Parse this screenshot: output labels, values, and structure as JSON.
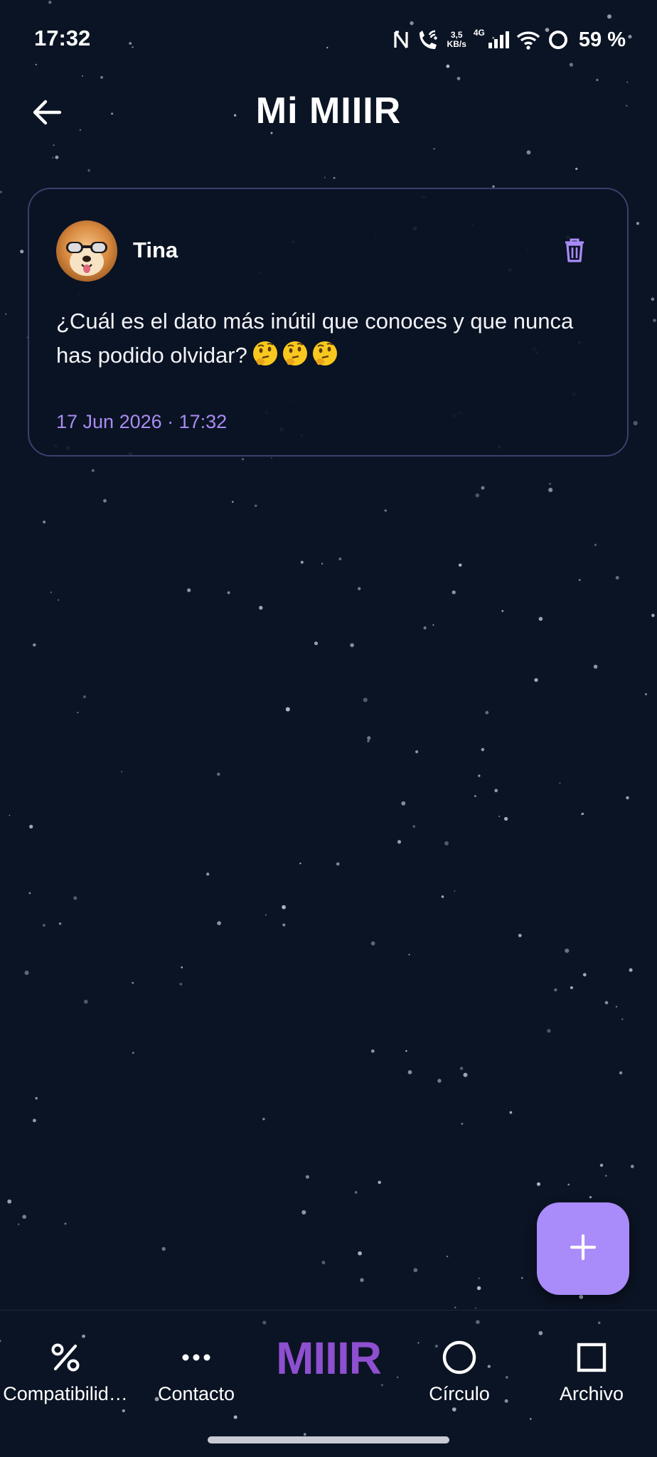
{
  "status_bar": {
    "time": "17:32",
    "net_speed_value": "3,5",
    "net_speed_unit": "KB/s",
    "network_type": "4G",
    "battery": "59 %"
  },
  "header": {
    "title": "Mi MIIIR"
  },
  "post": {
    "author": "Tina",
    "text": "¿Cuál es el dato más inútil que conoces y que nunca has podido olvidar?",
    "emojis": [
      "thinking-face",
      "thinking-face",
      "thinking-face"
    ],
    "date": "17 Jun 2026 · 17:32"
  },
  "bottom_nav": {
    "items": [
      {
        "label": "Compatibilid…",
        "icon": "percent-icon"
      },
      {
        "label": "Contacto",
        "icon": "more-dots-icon"
      },
      {
        "label": "MIIIR",
        "icon": "logo"
      },
      {
        "label": "Círculo",
        "icon": "circle-icon"
      },
      {
        "label": "Archivo",
        "icon": "square-icon"
      }
    ]
  },
  "colors": {
    "background": "#0b1424",
    "accent": "#a98bfa",
    "accent_text": "#a98bf2",
    "logo": "#8e4fd0",
    "card_border": "#3a3f6e"
  }
}
